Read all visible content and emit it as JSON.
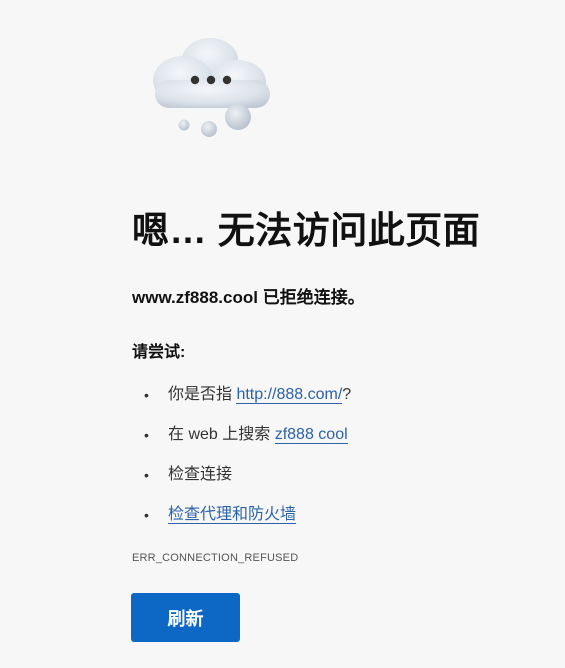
{
  "illustration": {
    "icon": "cloud-with-ellipsis-icon"
  },
  "headline": "嗯… 无法访问此页面",
  "subtitle": {
    "host": "www.zf888.cool",
    "message": " 已拒绝连接。"
  },
  "try_heading": "请尝试:",
  "suggestions": [
    {
      "prefix": "你是否指 ",
      "link": "http://888.com/",
      "suffix": "?"
    },
    {
      "prefix": "在 web 上搜索 ",
      "link": "zf888 cool",
      "suffix": ""
    },
    {
      "prefix": "检查连接",
      "link": "",
      "suffix": ""
    },
    {
      "prefix": "",
      "link": "检查代理和防火墙",
      "suffix": ""
    }
  ],
  "bullet": "•",
  "error_code": "ERR_CONNECTION_REFUSED",
  "refresh_label": "刷新",
  "colors": {
    "background": "#f7f7f7",
    "link": "#2c63a8",
    "button": "#0c68c4"
  }
}
